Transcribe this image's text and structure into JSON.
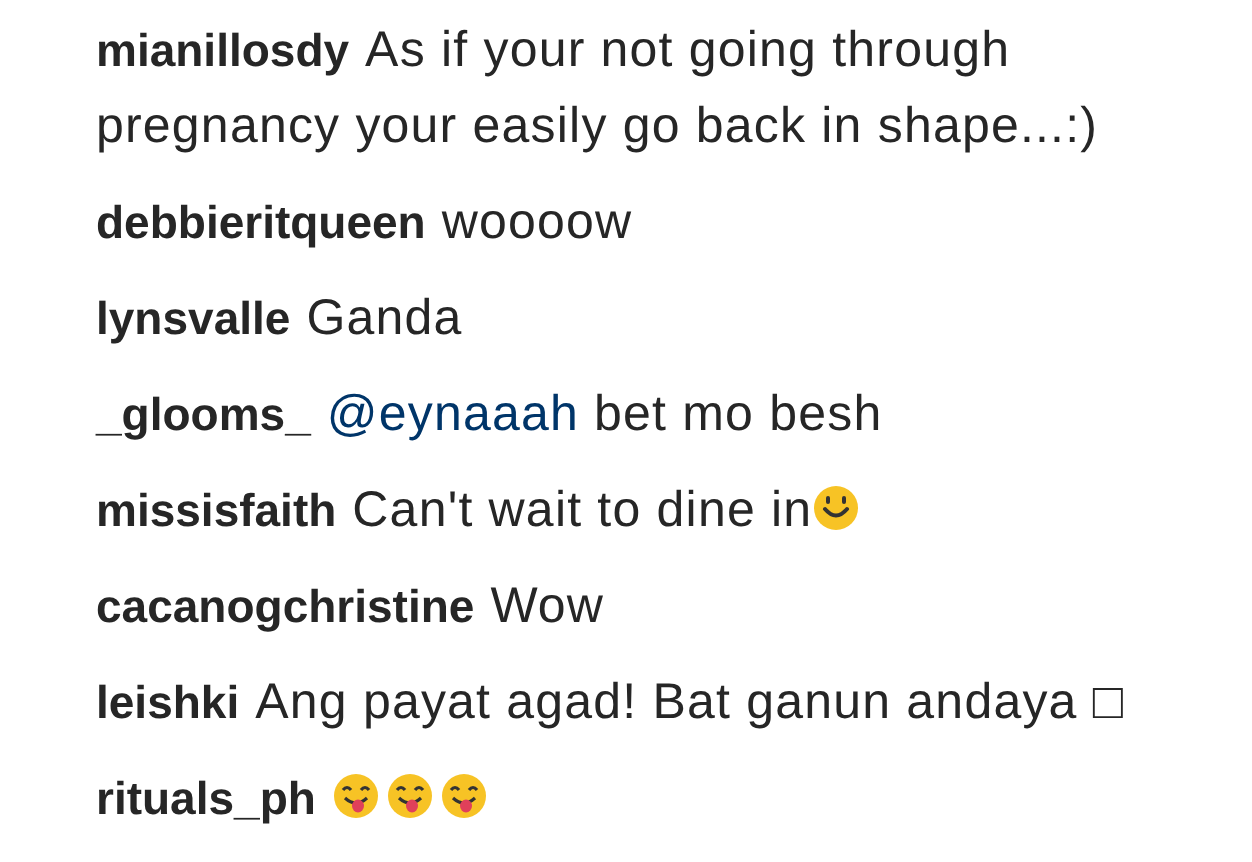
{
  "comments": [
    {
      "username": "mianillosdy",
      "parts": [
        {
          "kind": "text",
          "text": "As if your not going through pregnancy your easily go back in shape...:)"
        }
      ]
    },
    {
      "username": "debbieritqueen",
      "parts": [
        {
          "kind": "text",
          "text": "woooow"
        }
      ]
    },
    {
      "username": "lynsvalle",
      "parts": [
        {
          "kind": "text",
          "text": "Ganda"
        }
      ]
    },
    {
      "username": "_glooms_",
      "parts": [
        {
          "kind": "mention",
          "text": "@eynaaah"
        },
        {
          "kind": "text",
          "text": " bet mo besh"
        }
      ]
    },
    {
      "username": "missisfaith",
      "parts": [
        {
          "kind": "text",
          "text": "Can't wait to dine in"
        },
        {
          "kind": "smile-emoji"
        }
      ]
    },
    {
      "username": "cacanogchristine",
      "parts": [
        {
          "kind": "text",
          "text": "Wow"
        }
      ]
    },
    {
      "username": "leishki",
      "parts": [
        {
          "kind": "text",
          "text": "Ang payat agad! Bat ganun andaya □"
        }
      ]
    },
    {
      "username": "rituals_ph",
      "parts": [
        {
          "kind": "tongue-emoji"
        },
        {
          "kind": "tongue-emoji"
        },
        {
          "kind": "tongue-emoji"
        }
      ]
    }
  ]
}
